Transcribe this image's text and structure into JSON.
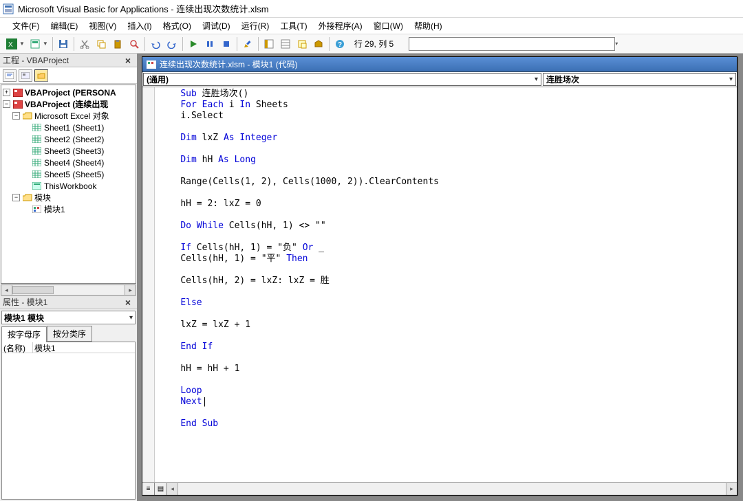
{
  "title": "Microsoft Visual Basic for Applications - 连续出现次数统计.xlsm",
  "menu": [
    "文件(F)",
    "编辑(E)",
    "视图(V)",
    "插入(I)",
    "格式(O)",
    "调试(D)",
    "运行(R)",
    "工具(T)",
    "外接程序(A)",
    "窗口(W)",
    "帮助(H)"
  ],
  "toolbar_status": "行 29, 列 5",
  "project_pane_title": "工程 - VBAProject",
  "tree": {
    "root1": "VBAProject (PERSONA",
    "root2": "VBAProject (连续出现",
    "excel_objs": "Microsoft Excel 对象",
    "sheets": [
      "Sheet1 (Sheet1)",
      "Sheet2 (Sheet2)",
      "Sheet3 (Sheet3)",
      "Sheet4 (Sheet4)",
      "Sheet5 (Sheet5)"
    ],
    "thiswb": "ThisWorkbook",
    "modules_folder": "模块",
    "module1": "模块1"
  },
  "props_title": "属性 - 模块1",
  "props_select": "模块1 模块",
  "props_tabs": [
    "按字母序",
    "按分类序"
  ],
  "props_row1_k": "(名称)",
  "props_row1_v": "模块1",
  "code_window_title": "连续出现次数统计.xlsm - 模块1 (代码)",
  "code_sel_left": "(通用)",
  "code_sel_right": "连胜场次",
  "code": {
    "l1a": "Sub",
    "l1b": " 连胜场次()",
    "l2a": "For Each",
    "l2b": " i ",
    "l2c": "In",
    "l2d": " Sheets",
    "l3": "i.Select",
    "l5a": "Dim",
    "l5b": " lxZ ",
    "l5c": "As Integer",
    "l7a": "Dim",
    "l7b": " hH ",
    "l7c": "As Long",
    "l9": "Range(Cells(1, 2), Cells(1000, 2)).ClearContents",
    "l11": "hH = 2: lxZ = 0",
    "l13a": "Do While",
    "l13b": " Cells(hH, 1) <> \"\"",
    "l15a": "If",
    "l15b": " Cells(hH, 1) = \"负\" ",
    "l15c": "Or",
    "l15d": " _",
    "l16a": "Cells(hH, 1) = \"平\" ",
    "l16b": "Then",
    "l18": "Cells(hH, 2) = lxZ: lxZ = 胜",
    "l20": "Else",
    "l22": "lxZ = lxZ + 1",
    "l24": "End If",
    "l26": "hH = hH + 1",
    "l28": "Loop",
    "l29a": "Next",
    "l29b": "|",
    "l31": "End Sub"
  }
}
